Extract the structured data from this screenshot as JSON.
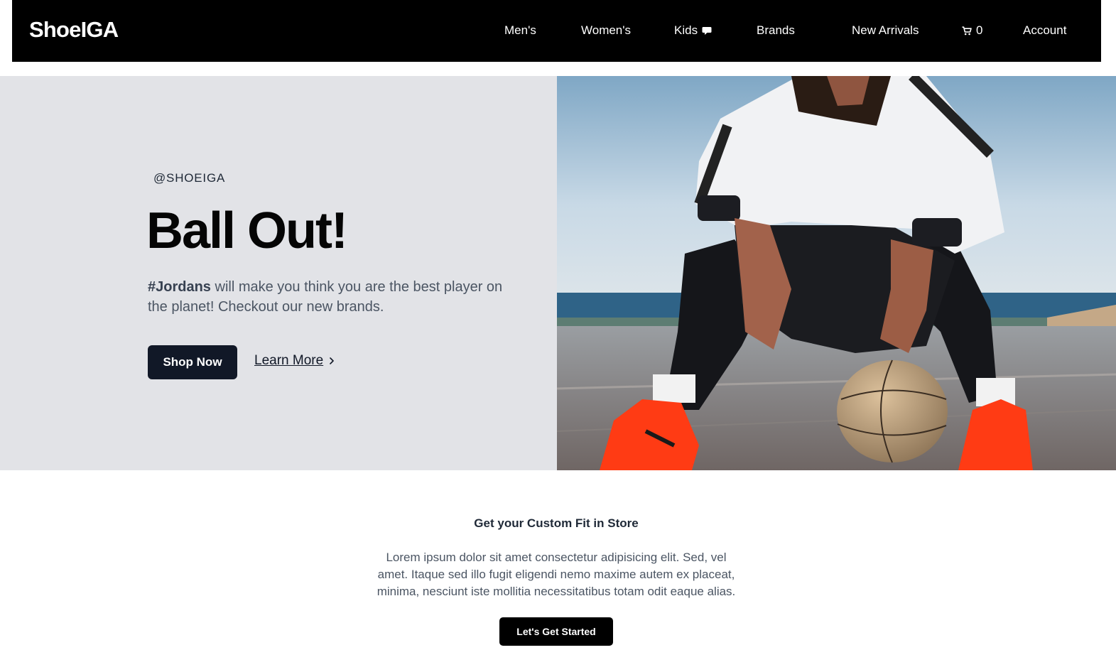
{
  "nav": {
    "logo": "ShoeIGA",
    "links": [
      {
        "label": "Men's"
      },
      {
        "label": "Women's"
      },
      {
        "label": "Kids"
      },
      {
        "label": "Brands"
      },
      {
        "label": "New Arrivals"
      }
    ],
    "cart_count": "0",
    "account": "Account",
    "kids_icon": "chat-bubble-icon",
    "cart_icon": "cart-icon"
  },
  "hero": {
    "eyebrow": "@SHOEIGA",
    "headline": "Ball Out!",
    "lede_bold": "#Jordans",
    "lede_rest": " will make you think you are the best player on the planet! Checkout our new brands.",
    "shop_button": "Shop Now",
    "learn_more": "Learn More",
    "learn_icon": "chevron-right-icon"
  },
  "promo": {
    "title": "Get your Custom Fit in Store",
    "body": "Lorem ipsum dolor sit amet consectetur adipisicing elit. Sed, vel amet. Itaque sed illo fugit eligendi nemo maxime autem ex placeat, minima, nesciunt iste mollitia necessitatibus totam odit eaque alias.",
    "button": "Let's Get Started"
  },
  "colors": {
    "nav_bg": "#000000",
    "hero_bg": "#e2e3e7",
    "button_dark": "#111827",
    "shoe_accent": "#ff3b14"
  }
}
